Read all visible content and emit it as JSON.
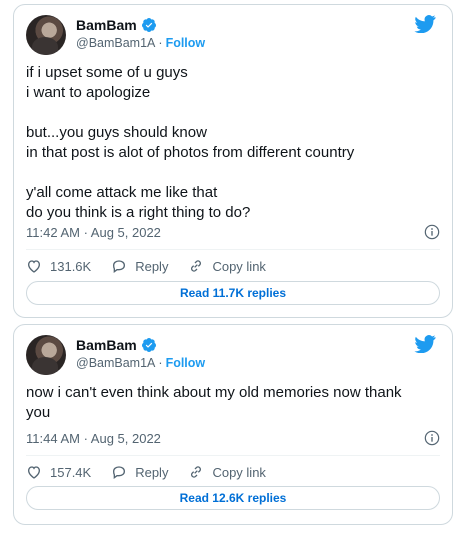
{
  "tweets": [
    {
      "author_name": "BamBam",
      "handle": "@BamBam1A",
      "separator": "·",
      "follow_label": "Follow",
      "text": "if i upset some of u guys\ni want to apologize\n\nbut...you guys should know\nin that post is alot of photos from different country\n\ny'all come attack me like that\ndo you think is a right thing to do?",
      "timestamp": "11:42 AM · Aug 5, 2022",
      "likes": "131.6K",
      "reply_label": "Reply",
      "copy_link_label": "Copy link",
      "read_replies_label": "Read 11.7K replies"
    },
    {
      "author_name": "BamBam",
      "handle": "@BamBam1A",
      "separator": "·",
      "follow_label": "Follow",
      "text": "now i can't even think about my old memories now thank\nyou",
      "timestamp": "11:44 AM · Aug 5, 2022",
      "likes": "157.4K",
      "reply_label": "Reply",
      "copy_link_label": "Copy link",
      "read_replies_label": "Read 12.6K replies"
    }
  ],
  "icons": {
    "verified": "verified-badge-icon",
    "brand": "twitter-bird-icon",
    "info": "info-icon",
    "like": "heart-icon",
    "reply": "reply-bubble-icon",
    "copy_link": "link-icon"
  },
  "colors": {
    "accent": "#1d9bf0",
    "read_replies": "#006fd6",
    "secondary_text": "#536471",
    "border": "#cfd9de"
  }
}
